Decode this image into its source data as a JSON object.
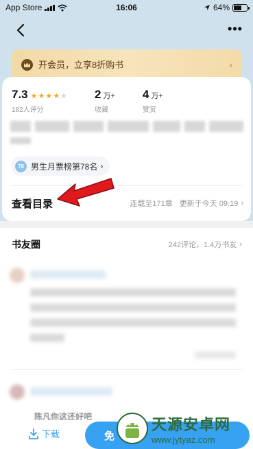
{
  "status_bar": {
    "carrier": "App Store",
    "time": "16:06",
    "battery_pct": "64%",
    "battery_level": 0.64
  },
  "vip_banner": {
    "text": "开会员，立享8折购书",
    "arrow": "›"
  },
  "stats": {
    "rating": "7.3",
    "rating_stars": 3.5,
    "rating_count": "182人评分",
    "favorites_num": "2",
    "favorites_unit": "万+",
    "favorites_label": "收藏",
    "likes_num": "4",
    "likes_unit": "万+",
    "likes_label": "赞赏"
  },
  "rank": {
    "badge": "78",
    "text": "男生月票榜第78名",
    "arrow": "›"
  },
  "toc": {
    "title": "查看目录",
    "serial": "连载至171章",
    "updated": "更新于今天 09:19",
    "arrow": "›"
  },
  "book_circle": {
    "title": "书友圈",
    "info": "242评论，1.4万书友",
    "arrow": "›",
    "partial_text": "陈凡你这还好吧"
  },
  "bottom": {
    "download_label": "下载",
    "free_label": "免"
  },
  "watermark": {
    "name": "天源安卓网",
    "url": "www.jytyaz.com"
  },
  "colors": {
    "accent": "#37a1f2",
    "star": "#f7a51c",
    "arrow_red": "#e0191f"
  }
}
